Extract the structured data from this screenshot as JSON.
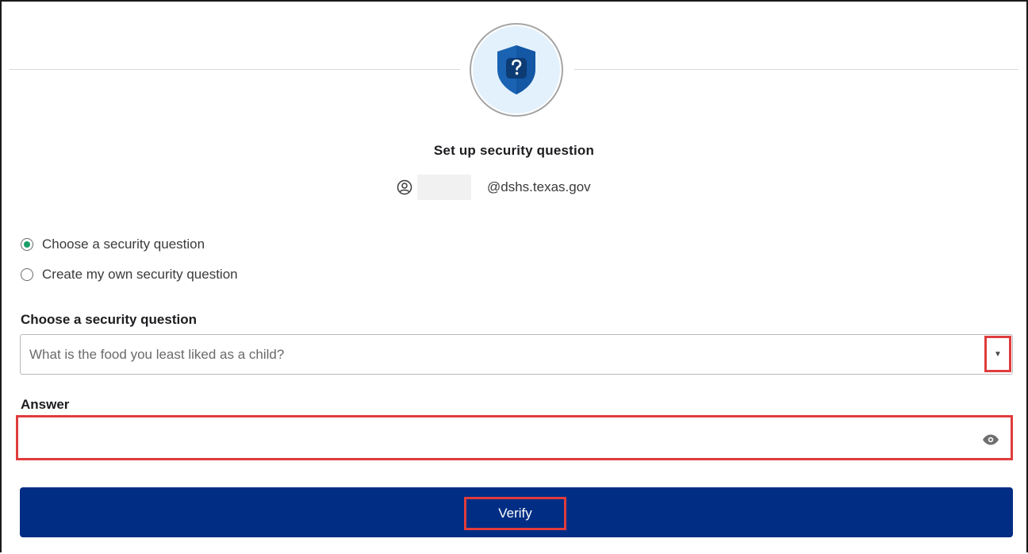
{
  "page": {
    "title": "Set up security question",
    "user": {
      "email_domain": "@dshs.texas.gov",
      "icon": "user-circle-icon"
    },
    "badge_icon": "shield-question-icon"
  },
  "options": [
    {
      "label": "Choose a security question",
      "checked": true
    },
    {
      "label": "Create my own security question",
      "checked": false
    }
  ],
  "question_field": {
    "label": "Choose a security question",
    "selected": "What is the food you least liked as a child?",
    "arrow": "▼"
  },
  "answer_field": {
    "label": "Answer",
    "value": "",
    "icon": "eye-icon"
  },
  "verify_button": {
    "label": "Verify"
  },
  "colors": {
    "accent": "#012d84",
    "radio_checked": "#1a9e68",
    "highlight": "#e03c3c",
    "shield": "#1a63b3",
    "badge_bg": "#e3f1fd"
  }
}
